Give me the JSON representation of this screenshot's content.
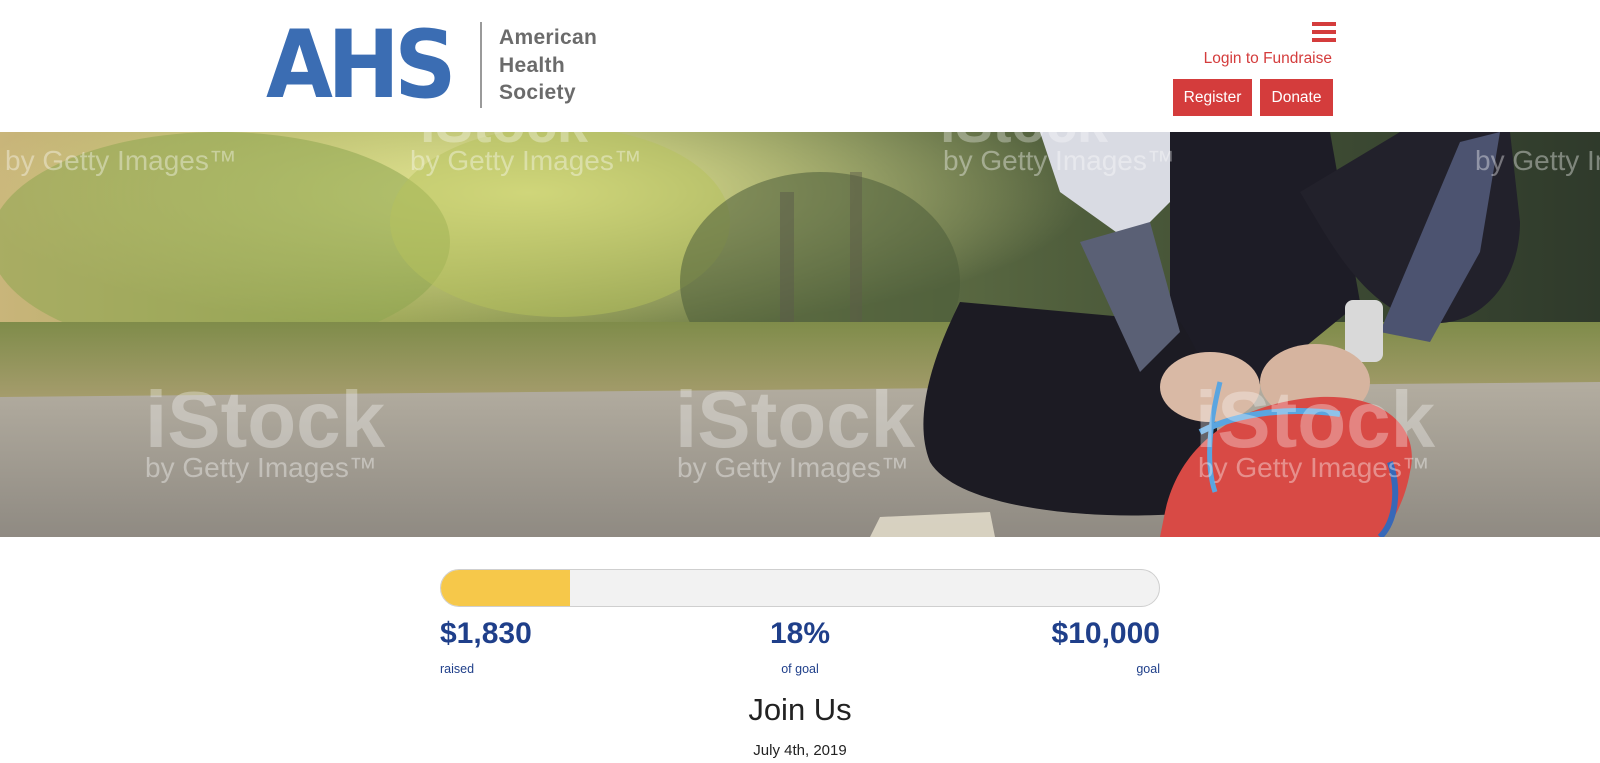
{
  "header": {
    "logo_mark": "AHS",
    "logo_lines": [
      "American",
      "Health",
      "Society"
    ],
    "login_label": "Login to Fundraise",
    "register_label": "Register",
    "donate_label": "Donate",
    "accent_color": "#d43c3c",
    "brand_color": "#3b6db3",
    "menu_icon": "hamburger-menu-icon"
  },
  "hero": {
    "watermark_brand": "iStock",
    "watermark_sub": "by Getty Images™"
  },
  "fundraising": {
    "progress_fraction": 0.18,
    "raised_value": "$1,830",
    "raised_label": "raised",
    "percent_value": "18%",
    "percent_label": "of goal",
    "goal_value": "$10,000",
    "goal_label": "goal",
    "bar_color": "#f6c84a"
  },
  "event": {
    "title": "Join Us",
    "date": "July 4th, 2019"
  }
}
